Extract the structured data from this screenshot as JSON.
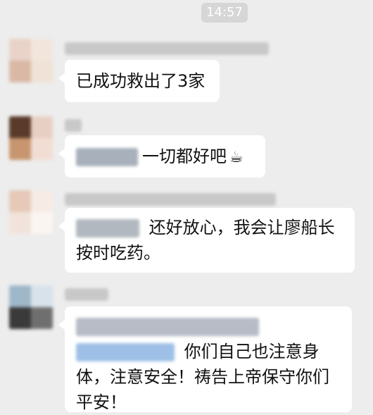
{
  "chat": {
    "timestamp": "14:57",
    "messages": [
      {
        "text": "已成功救出了3家"
      },
      {
        "text": "一切都好吧",
        "emoji": "☕"
      },
      {
        "line1": "还好放心，我会让廖船长",
        "line2": "按时吃药。"
      },
      {
        "line1": "你们自己也注意身",
        "line2": "体，注意安全！祷告上帝保守你们",
        "line3": "平安！"
      }
    ]
  }
}
